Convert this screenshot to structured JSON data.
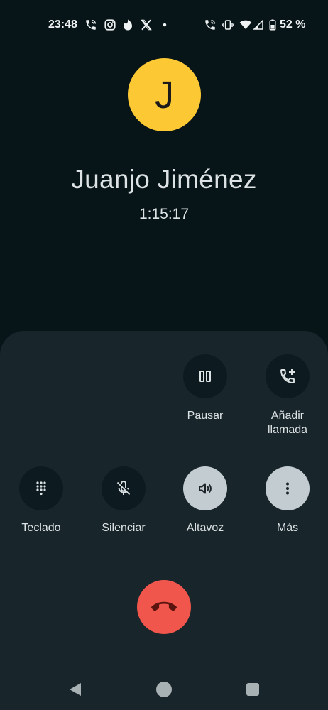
{
  "status_bar": {
    "time": "23:48",
    "left_icons": [
      "phone-call-icon",
      "instagram-icon",
      "tinder-icon",
      "x-icon",
      "dot-icon"
    ],
    "right_icons": [
      "phone-call-icon",
      "vibrate-icon",
      "wifi-icon",
      "signal-icon",
      "battery-icon"
    ],
    "battery_percent": "52 %"
  },
  "caller": {
    "initial": "J",
    "name": "Juanjo Jiménez",
    "duration": "1:15:17",
    "avatar_color": "#fcc934"
  },
  "controls": {
    "pause": {
      "label": "Pausar",
      "icon": "pause-icon"
    },
    "add_call": {
      "label_line1": "Añadir",
      "label_line2": "llamada",
      "icon": "add-call-icon"
    },
    "keypad": {
      "label": "Teclado",
      "icon": "dialpad-icon"
    },
    "mute": {
      "label": "Silenciar",
      "icon": "mic-off-icon"
    },
    "speaker": {
      "label": "Altavoz",
      "icon": "speaker-icon",
      "active": true
    },
    "more": {
      "label": "Más",
      "icon": "more-vert-icon",
      "active": true
    }
  },
  "end_call": {
    "icon": "end-call-icon",
    "color": "#f0564b"
  },
  "nav": {
    "icons": [
      "back-icon",
      "home-icon",
      "recents-icon"
    ]
  },
  "colors": {
    "background": "#071418",
    "sheet": "#18252b",
    "button_dark": "#0d1b20",
    "button_active": "#c3cdd1"
  }
}
